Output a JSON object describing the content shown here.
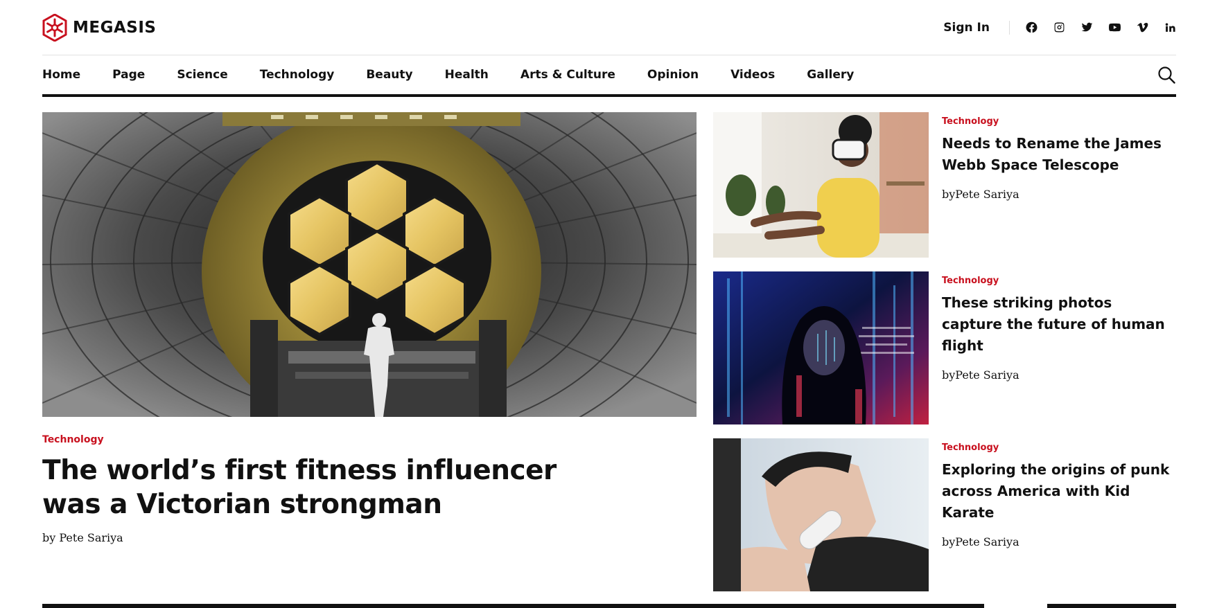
{
  "brand": {
    "name": "MEGASIS",
    "accent": "#c8101e"
  },
  "header": {
    "sign_in": "Sign In",
    "social": [
      "facebook-icon",
      "instagram-icon",
      "twitter-icon",
      "youtube-icon",
      "vimeo-icon",
      "linkedin-icon"
    ]
  },
  "nav": {
    "items": [
      "Home",
      "Page",
      "Science",
      "Technology",
      "Beauty",
      "Health",
      "Arts & Culture",
      "Opinion",
      "Videos",
      "Gallery"
    ],
    "search_icon": "search-icon"
  },
  "hero": {
    "category": "Technology",
    "title": "The world’s first fitness influencer was a Victorian strongman",
    "author": "by Pete Sariya"
  },
  "side_articles": [
    {
      "category": "Technology",
      "title": "Needs to Rename the James Webb Space Telescope",
      "author": "byPete Sariya"
    },
    {
      "category": "Technology",
      "title": "These striking photos capture the future of human flight",
      "author": "byPete Sariya"
    },
    {
      "category": "Technology",
      "title": "Exploring the origins of punk across America with Kid Karate",
      "author": "byPete Sariya"
    }
  ]
}
